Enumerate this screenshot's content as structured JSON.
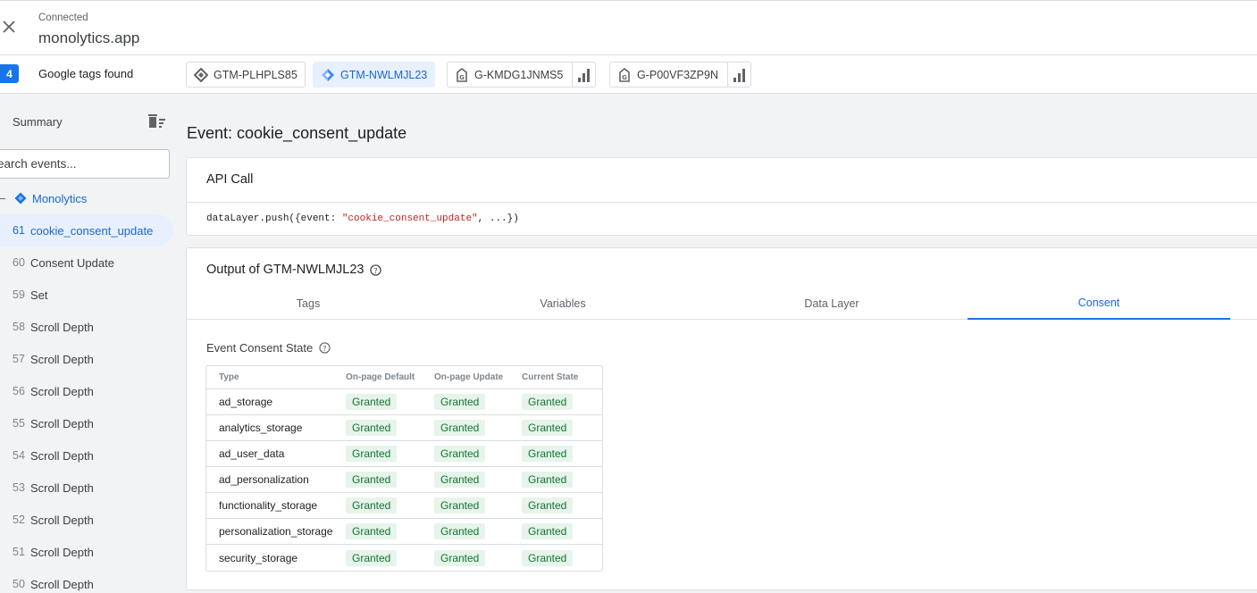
{
  "header": {
    "connection_label": "Connected",
    "host": "monolytics.app"
  },
  "tagbar": {
    "count": "4",
    "label": "Google tags found",
    "chips": [
      {
        "id": "GTM-PLHPLS85",
        "type": "gtm",
        "active": false
      },
      {
        "id": "GTM-NWLMJL23",
        "type": "gtm",
        "active": true
      },
      {
        "id": "G-KMDG1JNMS5",
        "type": "ga",
        "active": false
      },
      {
        "id": "G-P00VF3ZP9N",
        "type": "ga",
        "active": false
      }
    ]
  },
  "sidebar": {
    "summary": "Summary",
    "search_placeholder": "earch events...",
    "container": "Monolytics",
    "events": [
      {
        "num": "61",
        "label": "cookie_consent_update"
      },
      {
        "num": "60",
        "label": "Consent Update"
      },
      {
        "num": "59",
        "label": "Set"
      },
      {
        "num": "58",
        "label": "Scroll Depth"
      },
      {
        "num": "57",
        "label": "Scroll Depth"
      },
      {
        "num": "56",
        "label": "Scroll Depth"
      },
      {
        "num": "55",
        "label": "Scroll Depth"
      },
      {
        "num": "54",
        "label": "Scroll Depth"
      },
      {
        "num": "53",
        "label": "Scroll Depth"
      },
      {
        "num": "52",
        "label": "Scroll Depth"
      },
      {
        "num": "51",
        "label": "Scroll Depth"
      },
      {
        "num": "50",
        "label": "Scroll Depth"
      }
    ]
  },
  "main": {
    "event_title": "Event: cookie_consent_update",
    "api_card": {
      "title": "API Call",
      "code_prefix": "dataLayer.push({event: ",
      "code_string": "\"cookie_consent_update\"",
      "code_suffix": ", ...})"
    },
    "output": {
      "title": "Output of GTM-NWLMJL23",
      "tabs": [
        "Tags",
        "Variables",
        "Data Layer",
        "Consent"
      ],
      "active_tab": "Consent",
      "consent_title": "Event Consent State",
      "columns": [
        "Type",
        "On-page Default",
        "On-page Update",
        "Current State"
      ],
      "rows": [
        {
          "type": "ad_storage",
          "default": "Granted",
          "update": "Granted",
          "current": "Granted"
        },
        {
          "type": "analytics_storage",
          "default": "Granted",
          "update": "Granted",
          "current": "Granted"
        },
        {
          "type": "ad_user_data",
          "default": "Granted",
          "update": "Granted",
          "current": "Granted"
        },
        {
          "type": "ad_personalization",
          "default": "Granted",
          "update": "Granted",
          "current": "Granted"
        },
        {
          "type": "functionality_storage",
          "default": "Granted",
          "update": "Granted",
          "current": "Granted"
        },
        {
          "type": "personalization_storage",
          "default": "Granted",
          "update": "Granted",
          "current": "Granted"
        },
        {
          "type": "security_storage",
          "default": "Granted",
          "update": "Granted",
          "current": "Granted"
        }
      ]
    }
  },
  "colors": {
    "accent": "#1a73e8",
    "granted_bg": "#e6f4ea",
    "granted_text": "#137333"
  }
}
